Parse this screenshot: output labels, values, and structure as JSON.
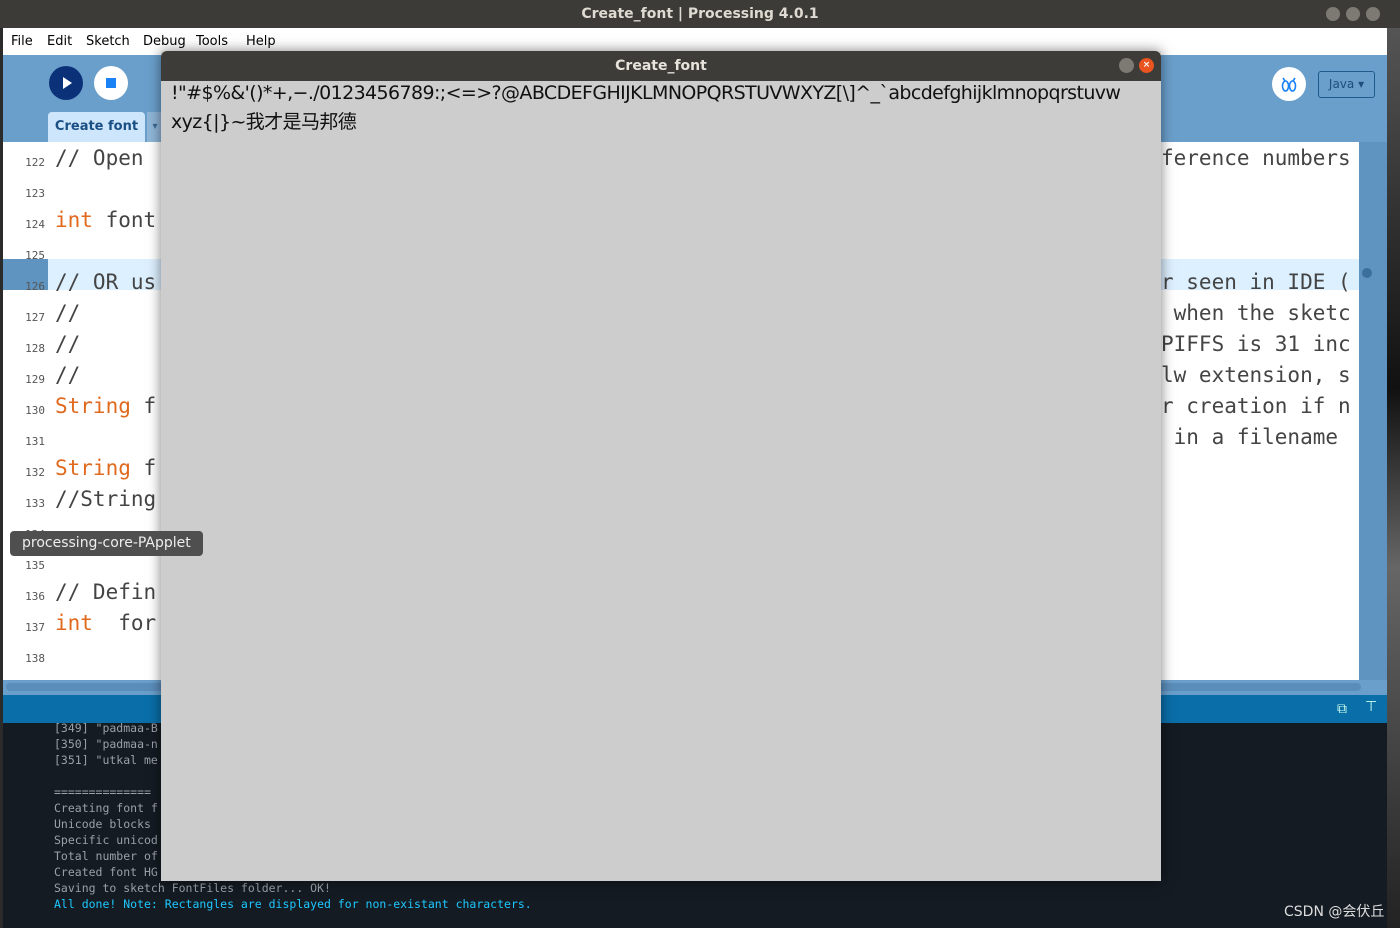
{
  "window": {
    "title": "Create_font | Processing 4.0.1"
  },
  "menu": [
    "File",
    "Edit",
    "Sketch",
    "Debug",
    "Tools",
    "Help"
  ],
  "toolbar": {
    "run": "run-icon",
    "stop": "stop-icon",
    "debug": "debugger-icon",
    "mode": "Java ▾"
  },
  "tab": {
    "label": "Create font",
    "arrow": "▾"
  },
  "editor": {
    "lines": [
      {
        "n": "122",
        "left": "// Open",
        "right": "ference numbers"
      },
      {
        "n": "123",
        "left": "",
        "right": ""
      },
      {
        "n": "124",
        "kw": "int",
        "left": " font",
        "right": ""
      },
      {
        "n": "125",
        "left": "",
        "right": ""
      },
      {
        "n": "126",
        "left": "// OR us",
        "right": "r seen in IDE (",
        "current": true
      },
      {
        "n": "127",
        "left": "//",
        "right": " when the sketc"
      },
      {
        "n": "128",
        "left": "//",
        "right": "PIFFS is 31 inc"
      },
      {
        "n": "129",
        "left": "//",
        "right": "lw extension, s"
      },
      {
        "n": "130",
        "kw": "String",
        "left": " f",
        "right": "r creation if n"
      },
      {
        "n": "131",
        "left": "",
        "right": " in a filename"
      },
      {
        "n": "132",
        "kw": "String",
        "left": " f",
        "right": ""
      },
      {
        "n": "133",
        "left": "//String",
        "right": ""
      },
      {
        "n": "134",
        "left": "",
        "right": ""
      },
      {
        "n": "135",
        "left": "",
        "right": ""
      },
      {
        "n": "136",
        "left": "// Defin",
        "right": ""
      },
      {
        "n": "137",
        "kw": "int",
        "left": "  for",
        "right": ""
      },
      {
        "n": "138",
        "left": "",
        "right": ""
      }
    ],
    "tooltip": "processing-core-PApplet"
  },
  "console": {
    "lines": [
      "[349] \"padmaa-B",
      "[350] \"padmaa-n",
      "[351] \"utkal me",
      "",
      "==============",
      "Creating font f",
      "Unicode blocks ",
      "Specific unicod",
      "Total number of",
      "Created font HG",
      "Saving to sketch FontFiles folder... OK!",
      "All done! Note: Rectangles are displayed for non-existant characters."
    ],
    "highlight_color": "#1ec8ff"
  },
  "dialog": {
    "title": "Create_font",
    "sample_line1": "!\"#$%&'()*+,−./0123456789:;<=>?@ABCDEFGHIJKLMNOPQRSTUVWXYZ[\\]^_`abcdefghijklmnopqrstuvw",
    "sample_line2": "xyz{|}~我才是马邦德"
  },
  "watermark": "CSDN @会伏丘"
}
